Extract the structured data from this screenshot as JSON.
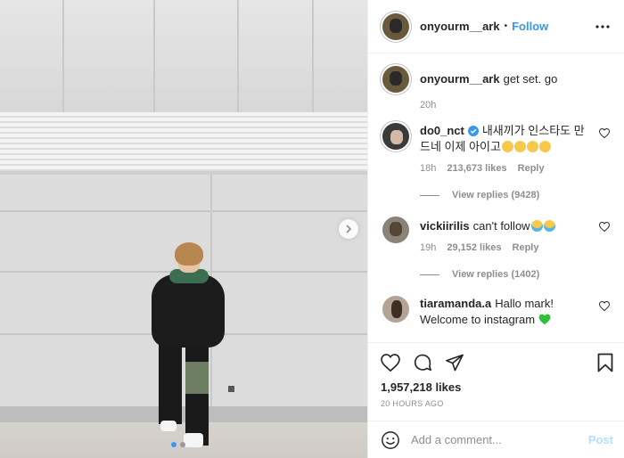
{
  "header": {
    "username": "onyourm__ark",
    "separator": "•",
    "follow_label": "Follow",
    "more_icon": "more-horizontal-icon"
  },
  "caption": {
    "username": "onyourm__ark",
    "text": "get set. go",
    "time": "20h"
  },
  "comments": [
    {
      "username": "do0_nct",
      "verified": true,
      "text": "내새끼가 인스타도 만드네 이제 아이고",
      "emoji": [
        "sad-face",
        "sad-face",
        "sad-face",
        "sad-face"
      ],
      "time": "18h",
      "likes": "213,673 likes",
      "reply_label": "Reply",
      "view_replies": "View replies (9428)"
    },
    {
      "username": "vickiirilis",
      "text": "can't follow",
      "emoji": [
        "crying-face",
        "crying-face"
      ],
      "time": "19h",
      "likes": "29,152 likes",
      "reply_label": "Reply",
      "view_replies": "View replies (1402)"
    },
    {
      "username": "tiaramanda.a",
      "text": "Hallo mark! Welcome to instagram",
      "emoji": [
        "green-heart"
      ]
    }
  ],
  "actions": {
    "like_icon": "heart-icon",
    "comment_icon": "comment-icon",
    "share_icon": "paper-plane-icon",
    "save_icon": "bookmark-icon",
    "likes_total": "1,957,218 likes",
    "posted": "20 HOURS AGO"
  },
  "add_comment": {
    "placeholder": "Add a comment...",
    "post_label": "Post",
    "emoji_icon": "smiley-icon"
  },
  "colors": {
    "link_blue": "#3897f0",
    "verified_blue": "#3897f0",
    "post_disabled": "#b2dffc",
    "muted_text": "#8e8e8e"
  }
}
